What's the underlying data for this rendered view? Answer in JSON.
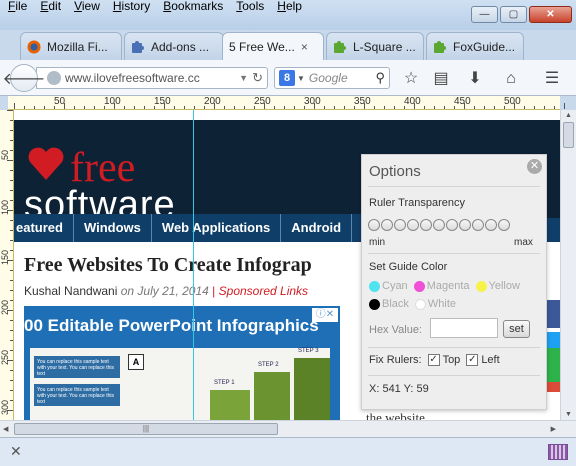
{
  "menubar": {
    "items": [
      "File",
      "Edit",
      "View",
      "History",
      "Bookmarks",
      "Tools",
      "Help"
    ]
  },
  "window": {
    "minimize": "—",
    "maximize": "▢",
    "close": "✕"
  },
  "tabs": [
    {
      "label": "Mozilla Fi...",
      "icon": "firefox-icon",
      "active": false
    },
    {
      "label": "Add-ons ...",
      "icon": "puzzle-icon",
      "active": false
    },
    {
      "label": "5 Free We...",
      "icon": "",
      "active": true,
      "close": "×"
    },
    {
      "label": "L-Square ...",
      "icon": "green-puzzle-icon",
      "active": false
    },
    {
      "label": "FoxGuide...",
      "icon": "green-puzzle-icon",
      "active": false
    }
  ],
  "newtab_label": "+",
  "navbar": {
    "url": "www.ilovefreesoftware.cc",
    "search_placeholder": "Google",
    "search_engine_letter": "8"
  },
  "ruler": {
    "top_ticks": [
      "50",
      "100",
      "150",
      "200",
      "250",
      "300",
      "350",
      "400",
      "450",
      "500"
    ],
    "left_ticks": [
      "50",
      "100",
      "150",
      "200",
      "250",
      "300"
    ]
  },
  "site": {
    "logo_free": "free",
    "logo_software": "software",
    "menu": [
      "eatured",
      "Windows",
      "Web Applications",
      "Android"
    ],
    "article_title": "Free Websites To Create Infograp",
    "author": "Kushal Nandwani",
    "date": "on July 21, 2014",
    "separator": "|",
    "sponsored": "Sponsored Links",
    "ad_title": "00 Editable PowerPoint Infographics",
    "ad_badge": "ⓘ✕",
    "ad_steps": [
      "STEP 1",
      "STEP 2",
      "STEP 3"
    ],
    "ad_text": "You can replace this sample text with your text. You can replace this text",
    "ad_letter": "A",
    "bottom_text": "the website"
  },
  "options": {
    "title": "Options",
    "close": "✕",
    "transparency_label": "Ruler Transparency",
    "transparency_level": 0,
    "min_label": "min",
    "max_label": "max",
    "guide_color_label": "Set Guide Color",
    "colors": [
      {
        "name": "Cyan",
        "hex": "#4fe3f0"
      },
      {
        "name": "Magenta",
        "hex": "#f04fd8"
      },
      {
        "name": "Yellow",
        "hex": "#f7f24a"
      },
      {
        "name": "Black",
        "hex": "#000000"
      },
      {
        "name": "White",
        "hex": "#ffffff"
      }
    ],
    "hex_label": "Hex Value:",
    "hex_value": "",
    "set_label": "set",
    "fix_label": "Fix Rulers:",
    "top_label": "Top",
    "left_label": "Left",
    "top_checked": true,
    "left_checked": true,
    "coords": "X: 541 Y: 59"
  }
}
